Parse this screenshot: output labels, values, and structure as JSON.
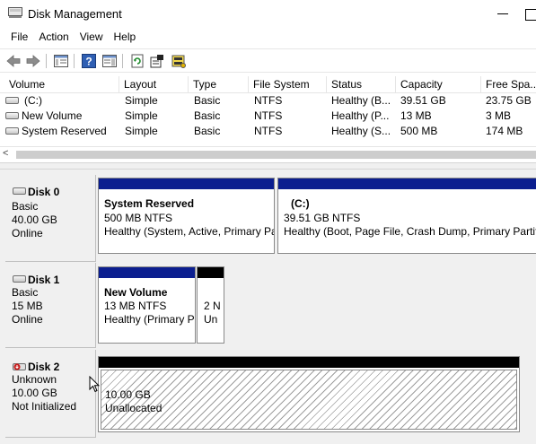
{
  "window": {
    "title": "Disk Management"
  },
  "menu": [
    "File",
    "Action",
    "View",
    "Help"
  ],
  "toolbar": {
    "buttons": [
      "back-icon",
      "forward-icon",
      "console-tree-icon",
      "help-icon",
      "action-pane-icon",
      "refresh-icon",
      "properties-icon",
      "rescan-icon"
    ]
  },
  "list": {
    "columns": [
      "Volume",
      "Layout",
      "Type",
      "File System",
      "Status",
      "Capacity",
      "Free Spa..."
    ],
    "rows": [
      {
        "volume": "(C:)",
        "layout": "Simple",
        "type": "Basic",
        "fs": "NTFS",
        "status": "Healthy (B...",
        "capacity": "39.51 GB",
        "free": "23.75 GB"
      },
      {
        "volume": "New Volume",
        "layout": "Simple",
        "type": "Basic",
        "fs": "NTFS",
        "status": "Healthy (P...",
        "capacity": "13 MB",
        "free": "3 MB"
      },
      {
        "volume": "System Reserved",
        "layout": "Simple",
        "type": "Basic",
        "fs": "NTFS",
        "status": "Healthy (S...",
        "capacity": "500 MB",
        "free": "174 MB"
      }
    ],
    "scroll_left": "<"
  },
  "disks": [
    {
      "name": "Disk 0",
      "type": "Basic",
      "size": "40.00 GB",
      "state": "Online",
      "partitions": [
        {
          "name": "System Reserved",
          "fs": "500 MB NTFS",
          "status": "Healthy (System, Active, Primary Pa"
        },
        {
          "name": "(C:)",
          "fs": "39.51 GB NTFS",
          "status": "Healthy (Boot, Page File, Crash Dump, Primary Partitio"
        }
      ]
    },
    {
      "name": "Disk 1",
      "type": "Basic",
      "size": "15 MB",
      "state": "Online",
      "partitions": [
        {
          "name": "New Volume",
          "fs": "13 MB NTFS",
          "status": "Healthy (Primary P"
        },
        {
          "name": "",
          "fs": "2 N",
          "status": "Un"
        }
      ]
    },
    {
      "name": "Disk 2",
      "type": "Unknown",
      "size": "10.00 GB",
      "state": "Not Initialized",
      "partitions": [
        {
          "size": "10.00 GB",
          "status": "Unallocated"
        }
      ]
    }
  ],
  "colors": {
    "primary_partition": "#0b1e8f",
    "unallocated": "#000000"
  }
}
